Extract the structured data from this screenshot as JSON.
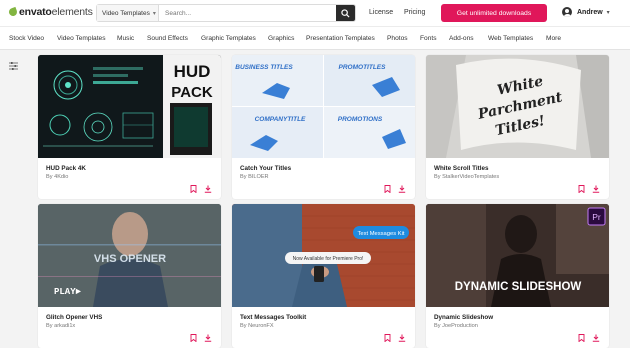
{
  "header": {
    "logo_brand": "envato",
    "logo_suffix": "elements",
    "category_select": "Video Templates",
    "search_placeholder": "Search...",
    "links": [
      "License",
      "Pricing"
    ],
    "cta": "Get unlimited downloads",
    "user_name": "Andrew"
  },
  "categories": [
    "Stock Video",
    "Video Templates",
    "Music",
    "Sound Effects",
    "Graphic Templates",
    "Graphics",
    "Presentation Templates",
    "Photos",
    "Fonts",
    "Add-ons",
    "Web Templates",
    "More"
  ],
  "cards": [
    {
      "title": "HUD Pack 4K",
      "author": "By 4Kdio",
      "thumb_text": [
        "HUD",
        "PACK"
      ]
    },
    {
      "title": "Catch Your Titles",
      "author": "By BILOER",
      "thumb_text": [
        "BUSINESS TITLES",
        "PROMOTITLES",
        "COMPANYTITLE",
        "PROMOTIONS"
      ]
    },
    {
      "title": "White Scroll Titles",
      "author": "By StalkerVideoTemplates",
      "thumb_text": [
        "White",
        "Parchment",
        "Titles!"
      ]
    },
    {
      "title": "Glitch Opener VHS",
      "author": "By arkadi1x",
      "thumb_text": [
        "VHS OPENER",
        "PLAY►"
      ]
    },
    {
      "title": "Text Messages Toolkit",
      "author": "By NeuronFX",
      "thumb_text": [
        "Text Messages Kit",
        "Now Available for Premiere Pro!"
      ]
    },
    {
      "title": "Dynamic Slideshow",
      "author": "By JoeProduction",
      "thumb_text": [
        "DYNAMIC SLIDESHOW",
        "Pr"
      ]
    }
  ],
  "colors": {
    "accent": "#e0175a",
    "brand_green": "#82b541",
    "icon_red": "#e0175a"
  }
}
